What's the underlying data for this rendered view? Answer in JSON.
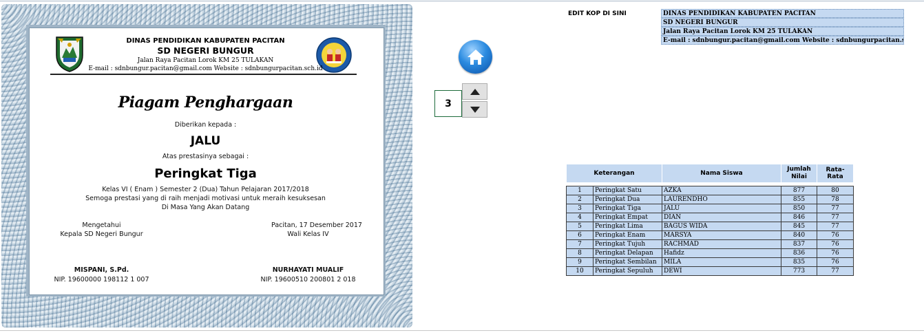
{
  "certificate": {
    "kop_line1": "DINAS PENDIDIKAN KABUPATEN PACITAN",
    "kop_line2": "SD NEGERI BUNGUR",
    "kop_line3": "Jalan Raya Pacitan Lorok KM 25 TULAKAN",
    "kop_line4": "E-mail : sdnbungur.pacitan@gmail.com Website : sdnbungurpacitan.sch.id",
    "title": "Piagam Penghargaan",
    "given_to_label": "Diberikan kepada :",
    "recipient": "JALU",
    "achievement_label": "Atas prestasinya sebagai :",
    "achievement": "Peringkat Tiga",
    "detail_line1": "Kelas VI ( Enam ) Semester 2 (Dua) Tahun Pelajaran 2017/2018",
    "detail_line2": "Semoga prestasi yang di raih menjadi motivasi untuk meraih kesuksesan",
    "detail_line3": "Di Masa Yang Akan Datang",
    "left_sig_line1": "Mengetahui",
    "left_sig_line2": "Kepala SD Negeri Bungur",
    "left_sig_name": "MISPANI, S.Pd.",
    "left_sig_nip": "NIP. 19600000 198112 1 007",
    "right_sig_line1": "Pacitan, 17 Desember 2017",
    "right_sig_line2": "Wali Kelas IV",
    "right_sig_name": "NURHAYATI MUALIF",
    "right_sig_nip": "NIP. 19600510 200801 2 018"
  },
  "controls": {
    "home_icon": "home-icon",
    "rank_value": "3",
    "up_icon": "triangle-up-icon",
    "down_icon": "triangle-down-icon"
  },
  "edit_kop": {
    "label": "EDIT KOP DI SINI",
    "lines": [
      "DINAS PENDIDIKAN KABUPATEN PACITAN",
      "SD NEGERI BUNGUR",
      "Jalan Raya Pacitan Lorok KM 25 TULAKAN",
      "E-mail : sdnbungur.pacitan@gmail.com Website : sdnbungurpacitan.sch.id"
    ]
  },
  "ranking": {
    "headers": {
      "keterangan": "Keterangan",
      "nama": "Nama Siswa",
      "jumlah": "Jumlah Nilai",
      "rata": "Rata-Rata"
    },
    "rows": [
      {
        "no": "1",
        "ket": "Peringkat Satu",
        "nama": "AZKA",
        "jumlah": "877",
        "rata": "80"
      },
      {
        "no": "2",
        "ket": "Peringkat Dua",
        "nama": "LAURENDHO",
        "jumlah": "855",
        "rata": "78"
      },
      {
        "no": "3",
        "ket": "Peringkat Tiga",
        "nama": "JALU",
        "jumlah": "850",
        "rata": "77"
      },
      {
        "no": "4",
        "ket": "Peringkat Empat",
        "nama": "DIAN",
        "jumlah": "846",
        "rata": "77"
      },
      {
        "no": "5",
        "ket": "Peringkat Lima",
        "nama": "BAGUS WIDA",
        "jumlah": "845",
        "rata": "77"
      },
      {
        "no": "6",
        "ket": "Peringkat Enam",
        "nama": "MARSYA",
        "jumlah": "840",
        "rata": "76"
      },
      {
        "no": "7",
        "ket": "Peringkat Tujuh",
        "nama": "RACHMAD",
        "jumlah": "837",
        "rata": "76"
      },
      {
        "no": "8",
        "ket": "Peringkat Delapan",
        "nama": "Hafidz",
        "jumlah": "836",
        "rata": "76"
      },
      {
        "no": "9",
        "ket": "Peringkat Sembilan",
        "nama": "MILA",
        "jumlah": "835",
        "rata": "76"
      },
      {
        "no": "10",
        "ket": "Peringkat Sepuluh",
        "nama": "DEWI",
        "jumlah": "773",
        "rata": "77"
      }
    ]
  }
}
